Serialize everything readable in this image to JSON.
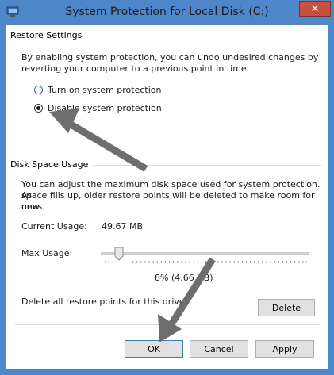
{
  "window": {
    "title": "System Protection for Local Disk (C:)",
    "close_glyph": "✕"
  },
  "restore_settings": {
    "group_label": "Restore Settings",
    "description_line1": "By enabling system protection, you can undo undesired changes by",
    "description_line2": "reverting your computer to a previous point in time.",
    "options": [
      {
        "label": "Turn on system protection",
        "selected": false
      },
      {
        "label": "Disable system protection",
        "selected": true
      }
    ]
  },
  "disk_space": {
    "group_label": "Disk Space Usage",
    "description_line1": "You can adjust the maximum disk space used for system protection. As",
    "description_line2": "space fills up, older restore points will be deleted to make room for new",
    "description_line3": "ones.",
    "current_usage_label": "Current Usage:",
    "current_usage_value": "49.67 MB",
    "max_usage_label": "Max Usage:",
    "max_usage_percent": 8,
    "max_usage_text": "8% (4.66 GB)",
    "delete_text": "Delete all restore points for this drive.",
    "delete_label": "Delete"
  },
  "buttons": {
    "ok": "OK",
    "cancel": "Cancel",
    "apply": "Apply"
  },
  "colors": {
    "window_frame": "#4e87c9",
    "close_button": "#c7503e",
    "annotation_arrow": "#6e6e6e"
  },
  "icons": {
    "app": "system-drive-icon",
    "close": "close-icon"
  }
}
